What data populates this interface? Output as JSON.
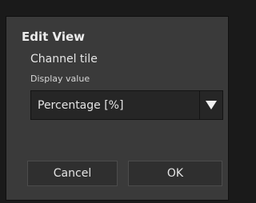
{
  "dialog": {
    "title": "Edit View",
    "section_label": "Channel tile",
    "field_label": "Display value",
    "display_value": {
      "selected": "Percentage [%]",
      "arrow_icon": "triangle-down-icon"
    },
    "buttons": {
      "cancel_label": "Cancel",
      "ok_label": "OK"
    }
  },
  "colors": {
    "background": "#1a1a1a",
    "dialog": "#3a3a3a",
    "field": "#262626",
    "button": "#2f2f2f",
    "text": "#e4e4e4"
  }
}
